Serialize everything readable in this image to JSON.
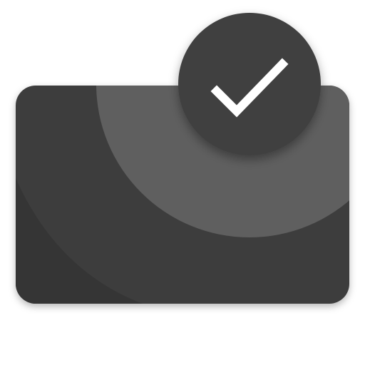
{
  "icon": {
    "name": "card-verified-app-icon",
    "card_icon": "card-icon",
    "badge_icon": "checkmark-icon",
    "colors": {
      "background": "#ffffff",
      "card_base": "#3d3d3d",
      "card_dark_arc": "#353535",
      "card_light_arc": "#5f5f5f",
      "badge": "#404040",
      "check": "#ffffff",
      "shadow": "#000000"
    }
  }
}
